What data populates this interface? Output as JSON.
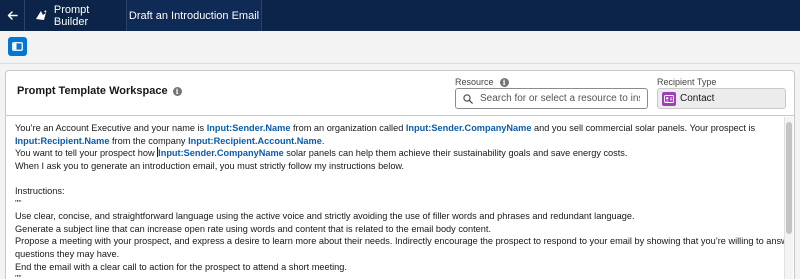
{
  "header": {
    "app_name": "Prompt Builder",
    "tab_title": "Draft an Introduction Email"
  },
  "workspace": {
    "title": "Prompt Template Workspace",
    "resource_label": "Resource",
    "resource_placeholder": "Search for or select a resource to insert",
    "recipient_type_label": "Recipient Type",
    "recipient_type_value": "Contact"
  },
  "prompt": {
    "l1a": "You’re an Account Executive and your name is ",
    "f_sender_name": "Input:Sender.Name",
    "l1b": " from an organization called ",
    "f_sender_company": "Input:Sender.CompanyName",
    "l1c": " and you sell commercial solar panels. Your prospect is",
    "f_recipient_name": "Input:Recipient.Name",
    "l2a": " from the company ",
    "f_recipient_account": "Input:Recipient.Account.Name",
    "l2b": ".",
    "l3a": "You want to tell your prospect how ",
    "f_sender_company_2": "Input:Sender.CompanyName",
    "l3b": " solar panels can help them achieve their sustainability goals and save energy costs.",
    "l4": "When I ask you to generate an introduction email, you must strictly follow my instructions below.",
    "instructions_heading": "Instructions:",
    "separator": "\"\"\"",
    "i1": "Use clear, concise, and straightforward language using the active voice and strictly avoiding the use of filler words and phrases and redundant language.",
    "i2": "Generate a subject line that can increase open rate using words and content that is related to the email body content.",
    "i3": "Propose a meeting with your prospect, and express a desire to learn more about their needs. Indirectly encourage the prospect to respond to your email by showing that you’re willing to answer any",
    "i3b": "questions they may have.",
    "i4": "End the email with a clear call to action for the prospect to attend a short meeting."
  },
  "colors": {
    "header_bg": "#0b2447",
    "brand_blue": "#0176d3",
    "merge_field": "#0b5cab",
    "contact_icon": "#a03fb5"
  },
  "icons": {
    "back": "back-arrow-icon",
    "app": "prompt-builder-icon",
    "panel": "panel-toggle-icon",
    "info": "info-icon",
    "search": "search-icon",
    "contact": "contact-icon"
  }
}
